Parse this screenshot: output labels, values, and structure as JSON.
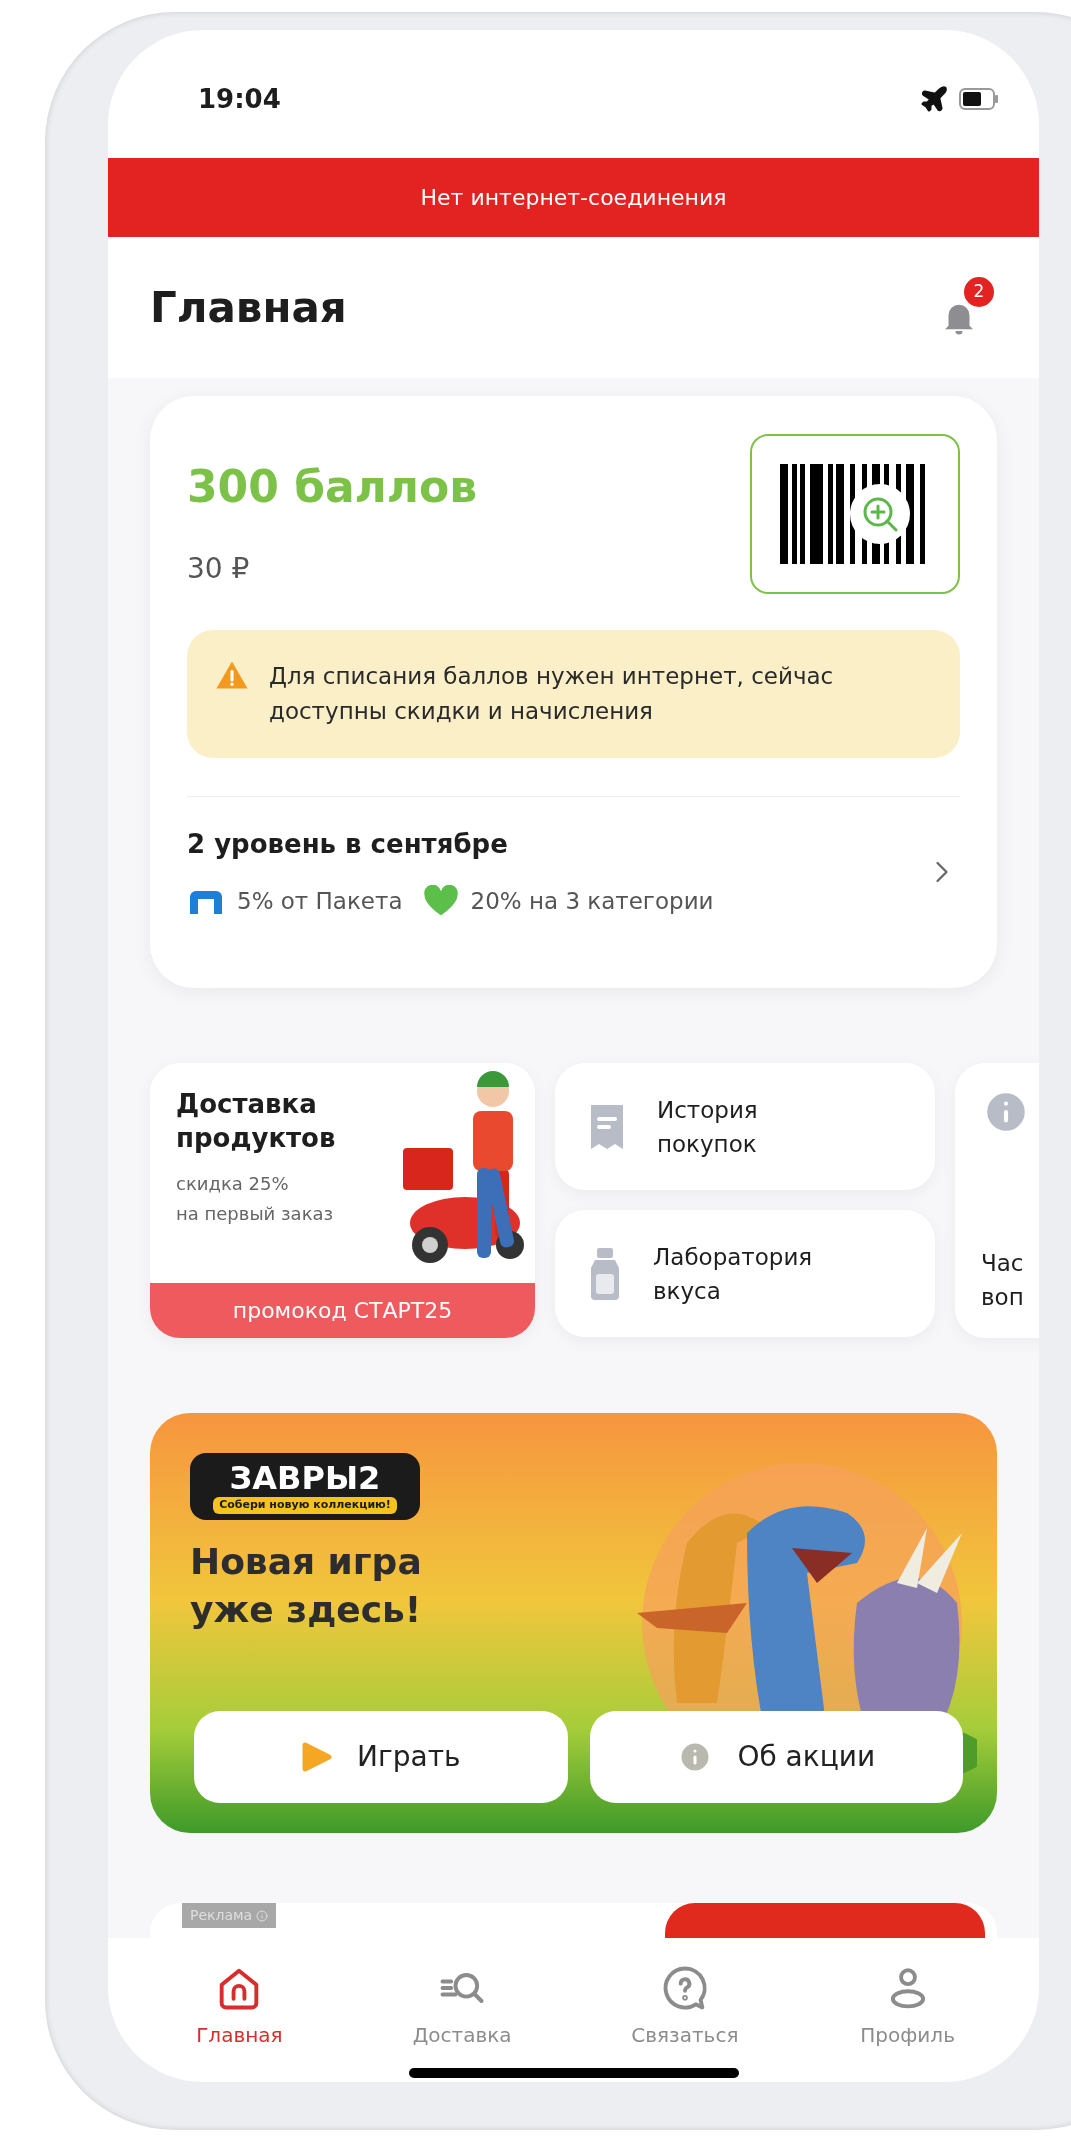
{
  "status_bar": {
    "time": "19:04"
  },
  "offline_banner": {
    "text": "Нет интернет-соединения"
  },
  "header": {
    "title": "Главная",
    "notifications_badge": "2"
  },
  "loyalty_card": {
    "points": "300 баллов",
    "rubles": "30 ₽",
    "warning": "Для списания баллов нужен интернет, сейчас доступны скидки и начисления",
    "level_title": "2 уровень в сентябре",
    "perks": [
      {
        "text": "5% от Пакета"
      },
      {
        "text": "20% на 3 категории"
      }
    ]
  },
  "delivery_tile": {
    "title": "Доставка продуктов",
    "subtitle_lines": [
      "скидка 25%",
      "на первый заказ"
    ],
    "promo": "промокод СТАРТ25"
  },
  "tiles": [
    {
      "label": "История покупок"
    },
    {
      "label": "Лаборатория вкуса"
    }
  ],
  "partial_tile": {
    "lines": [
      "Час",
      "воп"
    ]
  },
  "promo_banner": {
    "logo_title": "ЗАВРЫ2",
    "logo_subtitle": "Собери новую коллекцию!",
    "heading": "Новая игра уже здесь!",
    "buttons": [
      "Играть",
      "Об акции"
    ]
  },
  "ad": {
    "label": "Реклама"
  },
  "tab_bar": [
    {
      "label": "Главная",
      "selected": true
    },
    {
      "label": "Доставка",
      "selected": false
    },
    {
      "label": "Связаться",
      "selected": false
    },
    {
      "label": "Профиль",
      "selected": false
    }
  ]
}
